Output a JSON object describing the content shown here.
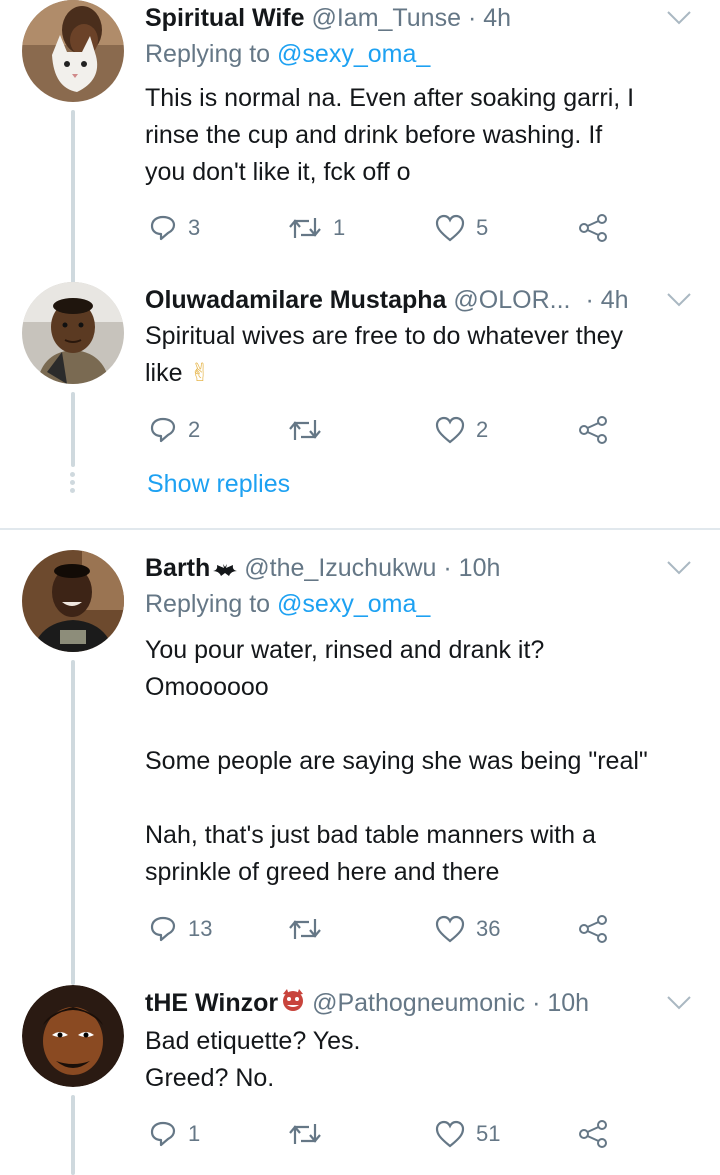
{
  "tweets": [
    {
      "name": "Spiritual Wife",
      "handle": "@Iam_Tunse",
      "time": "· 4h",
      "replying_label": "Replying to",
      "replying_handle": "@sexy_oma_",
      "text": "This is normal na. Even after soaking garri, I\nrinse the cup and drink before washing. If\nyou don't like it, fck off o",
      "replies": "3",
      "retweets": "1",
      "likes": "5"
    },
    {
      "name": "Oluwadamilare Mustapha",
      "handle": "@OLOR...",
      "time": "· 4h",
      "text": "Spiritual wives are free to do whatever they\nlike",
      "emoji": "✌",
      "replies": "2",
      "retweets": "",
      "likes": "2"
    },
    {
      "name": "Barth",
      "handle": "@the_Izuchukwu",
      "time": "· 10h",
      "replying_label": "Replying to",
      "replying_handle": "@sexy_oma_",
      "text": "You pour water, rinsed and drank it?\nOmoooooo\n\nSome people are saying she was being \"real\"\n\nNah, that's just bad table manners with a\nsprinkle of greed here and there",
      "replies": "13",
      "retweets": "",
      "likes": "36"
    },
    {
      "name": "tHE Winzor",
      "handle": "@Pathogneumonic",
      "time": "· 10h",
      "text": "Bad etiquette? Yes.\nGreed? No.",
      "replies": "1",
      "retweets": "",
      "likes": "51"
    }
  ],
  "show_replies": "Show replies",
  "colors": {
    "link": "#1da1f2",
    "meta": "#657786",
    "thread_line": "#cfd9de"
  },
  "icons": [
    "reply-icon",
    "retweet-icon",
    "like-icon",
    "share-icon",
    "chevron-down-icon"
  ]
}
